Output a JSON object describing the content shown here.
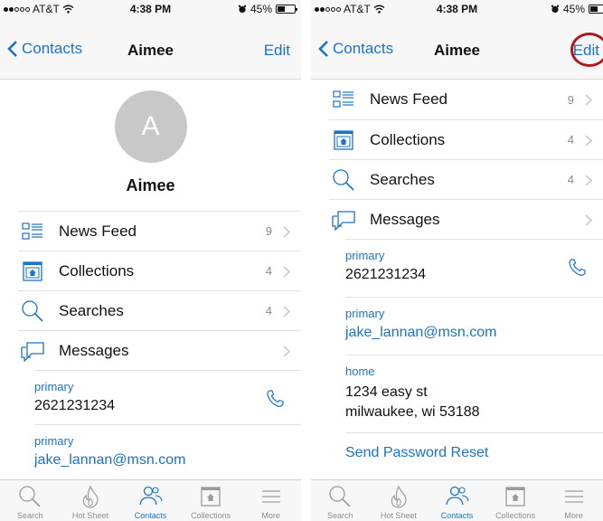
{
  "status_bar": {
    "carrier": "AT&T",
    "time": "4:38 PM",
    "battery": "45%",
    "battery_level": 0.45
  },
  "nav": {
    "back_label": "Contacts",
    "title": "Aimee",
    "edit_label": "Edit"
  },
  "contact": {
    "initial": "A",
    "name": "Aimee"
  },
  "menu": [
    {
      "label": "News Feed",
      "count": "9",
      "icon": "news-feed-icon"
    },
    {
      "label": "Collections",
      "count": "4",
      "icon": "collections-icon"
    },
    {
      "label": "Searches",
      "count": "4",
      "icon": "search-icon"
    },
    {
      "label": "Messages",
      "count": "",
      "icon": "messages-icon"
    }
  ],
  "phone": {
    "label": "primary",
    "value": "2621231234"
  },
  "email": {
    "label": "primary",
    "value": "jake_lannan@msn.com"
  },
  "address": {
    "label": "home",
    "line1": "1234 easy st",
    "line2": "milwaukee, wi 53188"
  },
  "send_reset_label": "Send Password Reset",
  "tabs": [
    {
      "label": "Search",
      "icon": "search-icon"
    },
    {
      "label": "Hot Sheet",
      "icon": "flame-icon"
    },
    {
      "label": "Contacts",
      "icon": "contacts-icon",
      "active": true
    },
    {
      "label": "Collections",
      "icon": "collections-icon"
    },
    {
      "label": "More",
      "icon": "menu-icon"
    }
  ],
  "colors": {
    "accent": "#1a73c7",
    "highlight_circle": "#b0171a",
    "avatar_bg": "#c8c8c8"
  }
}
